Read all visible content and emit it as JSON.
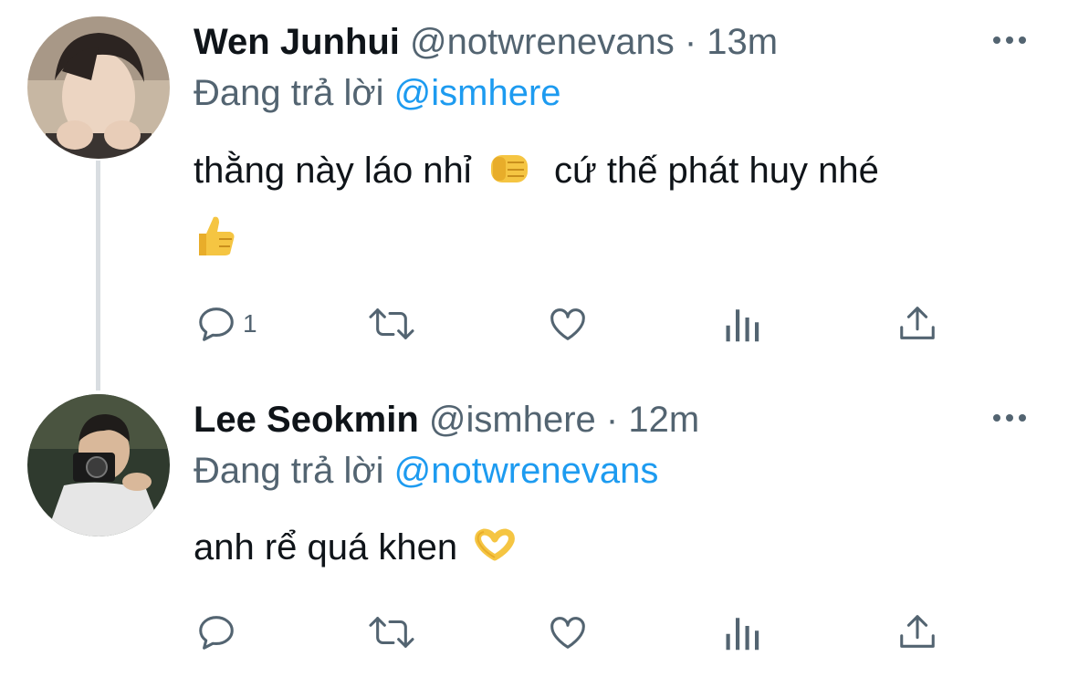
{
  "tweets": [
    {
      "name": "Wen Junhui",
      "handle": "@notwrenevans",
      "separator": "·",
      "time": "13m",
      "replying_prefix": "Đang trả lời",
      "replying_to": "@ismhere",
      "text_part1": "thằng này láo nhỉ",
      "emoji1": "fist-bump-emoji",
      "text_part2": "cứ thế phát huy nhé",
      "emoji2": "thumbs-up-emoji",
      "reply_count": "1",
      "actions": [
        "reply-icon",
        "retweet-icon",
        "like-icon",
        "views-icon",
        "share-icon"
      ]
    },
    {
      "name": "Lee Seokmin",
      "handle": "@ismhere",
      "separator": "·",
      "time": "12m",
      "replying_prefix": "Đang trả lời",
      "replying_to": "@notwrenevans",
      "text_part1": "anh rể quá khen",
      "emoji1": "heart-hands-emoji",
      "reply_count": "",
      "actions": [
        "reply-icon",
        "retweet-icon",
        "like-icon",
        "views-icon",
        "share-icon"
      ]
    }
  ],
  "colors": {
    "text": "#0f1419",
    "secondary": "#536471",
    "mention": "#1d9bf0",
    "thread_line": "#d9dde1",
    "emoji": "#f5c542"
  }
}
